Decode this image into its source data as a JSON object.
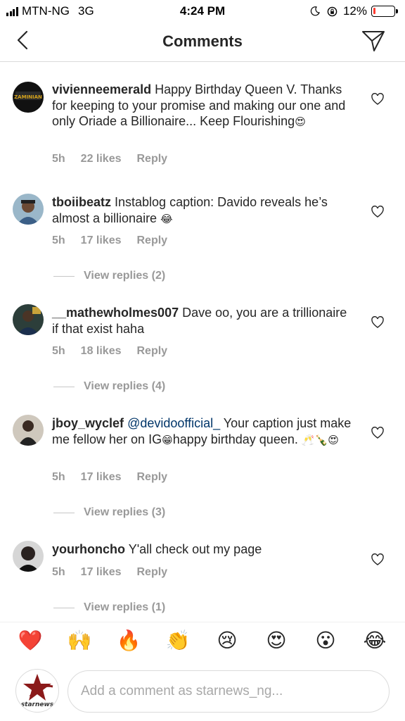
{
  "status_bar": {
    "carrier": "MTN-NG",
    "network": "3G",
    "time": "4:24 PM",
    "battery": "12%",
    "battery_level": 0.12,
    "battery_color": "#ff3b30"
  },
  "header": {
    "title": "Comments",
    "back_icon": "chevron-left-icon",
    "share_icon": "paper-plane-icon"
  },
  "comments": [
    {
      "username": "vivienneemerald",
      "text": "Happy Birthday Queen V. Thanks for keeping to your promise and making our one and only Oriade a Billionaire... Keep Flourishing",
      "emoji": "😍",
      "time": "5h",
      "likes": "22 likes",
      "reply": "Reply"
    },
    {
      "username": "tboiibeatz",
      "text": "Instablog caption: Davido reveals he’s almost a billionaire",
      "emoji": "😂",
      "time": "5h",
      "likes": "17 likes",
      "reply": "Reply",
      "view_replies": "View replies (2)"
    },
    {
      "username": "__mathewholmes007",
      "text": "Dave oo, you are a trillionaire if that exist haha",
      "time": "5h",
      "likes": "18 likes",
      "reply": "Reply",
      "view_replies": "View replies (4)"
    },
    {
      "username": "jboy_wyclef",
      "mention": "@devidoofficial_",
      "text": "Your caption just make me fellow her on IG",
      "emoji_inline": "😁",
      "text2": "happy birthday queen.",
      "emoji_end": "🥂🍾😍",
      "time": "5h",
      "likes": "17 likes",
      "reply": "Reply",
      "view_replies": "View replies (3)"
    },
    {
      "username": "yourhoncho",
      "text": "Y'all check out my page",
      "time": "5h",
      "likes": "17 likes",
      "reply": "Reply",
      "view_replies": "View replies (1)"
    }
  ],
  "reactions": [
    "❤️",
    "🙌",
    "🔥",
    "👏",
    "😢",
    "😍",
    "😮",
    "😂"
  ],
  "input": {
    "placeholder": "Add a comment as starnews_ng...",
    "avatar_label": "starnews"
  },
  "colors": {
    "text": "#262626",
    "meta": "#999999",
    "mention": "#003569"
  }
}
